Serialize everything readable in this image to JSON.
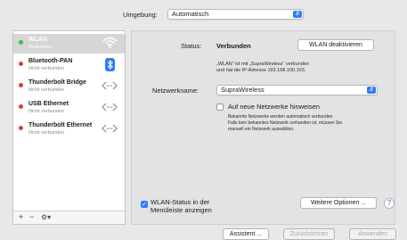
{
  "location": {
    "label": "Umgebung:",
    "value": "Automatisch"
  },
  "services": [
    {
      "name": "WLAN",
      "status": "Verbunden",
      "dot": "#3cc13c",
      "icon": "wifi-icon",
      "selected": true
    },
    {
      "name": "Bluetooth-PAN",
      "status": "Nicht verbunden",
      "dot": "#e63b2e",
      "icon": "bluetooth-icon",
      "selected": false
    },
    {
      "name": "Thunderbolt Bridge",
      "status": "Nicht verbunden",
      "dot": "#e63b2e",
      "icon": "ethernet-arrows-icon",
      "selected": false
    },
    {
      "name": "USB Ethernet",
      "status": "Nicht verbunden",
      "dot": "#e63b2e",
      "icon": "ethernet-arrows-icon",
      "selected": false
    },
    {
      "name": "Thunderbolt Ethernet",
      "status": "Nicht verbunden",
      "dot": "#e63b2e",
      "icon": "ethernet-arrows-icon",
      "selected": false
    }
  ],
  "sidebar_footer": {
    "add": "+",
    "remove": "−",
    "gear": "⚙▾"
  },
  "status": {
    "label": "Status:",
    "value": "Verbunden",
    "button": "WLAN deaktivieren",
    "description_line1": "„WLAN“ ist mit „SupraWireless“ verbunden",
    "description_line2": "und hat die IP-Adresse 192.168.100.103."
  },
  "network": {
    "label": "Netzwerkname:",
    "value": "SupraWireless"
  },
  "ask_join": {
    "label": "Auf neue Netzwerke hinweisen",
    "checked": false,
    "help_line1": "Bekannte Netzwerke werden automatisch verbunden.",
    "help_line2": "Falls kein bekanntes Netzwerk vorhanden ist, müssen Sie",
    "help_line3": "manuell ein Netzwerk auswählen."
  },
  "menubar_status": {
    "line1": "WLAN-Status in der",
    "line2": "Menüleiste anzeigen",
    "checked": true
  },
  "buttons": {
    "advanced": "Weitere Optionen ...",
    "help": "?",
    "assistant": "Assistent ...",
    "revert": "Zurücksetzen",
    "apply": "Anwenden"
  },
  "colors": {
    "accent": "#2f7cf6",
    "selected_row": "#d6d6d6"
  }
}
